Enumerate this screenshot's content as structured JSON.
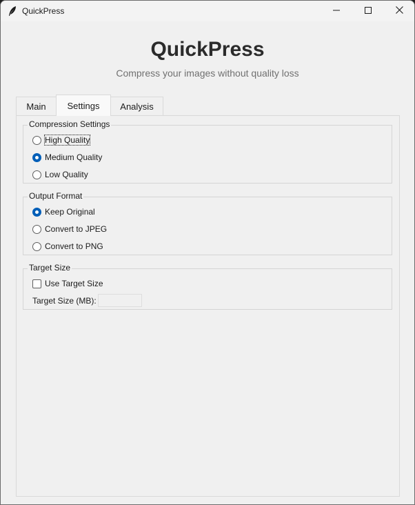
{
  "window": {
    "title": "QuickPress",
    "app_icon": "feather-icon",
    "controls": [
      "minimize-icon",
      "maximize-icon",
      "close-icon"
    ]
  },
  "header": {
    "title": "QuickPress",
    "subtitle": "Compress your images without quality loss"
  },
  "tabs": [
    {
      "label": "Main",
      "selected": false
    },
    {
      "label": "Settings",
      "selected": true
    },
    {
      "label": "Analysis",
      "selected": false
    }
  ],
  "settings": {
    "compression": {
      "title": "Compression Settings",
      "options": [
        {
          "label": "High Quality",
          "selected": false
        },
        {
          "label": "Medium Quality",
          "selected": true
        },
        {
          "label": "Low Quality",
          "selected": false
        }
      ]
    },
    "output_format": {
      "title": "Output Format",
      "options": [
        {
          "label": "Keep Original",
          "selected": true
        },
        {
          "label": "Convert to JPEG",
          "selected": false
        },
        {
          "label": "Convert to PNG",
          "selected": false
        }
      ]
    },
    "target_size": {
      "title": "Target Size",
      "checkbox_label": "Use Target Size",
      "checked": false,
      "field_label": "Target Size (MB):",
      "field_value": ""
    }
  },
  "colors": {
    "accent": "#005fb8",
    "background": "#f0f0f0",
    "title_text": "#2b2b2b",
    "subtitle_text": "#707070"
  }
}
